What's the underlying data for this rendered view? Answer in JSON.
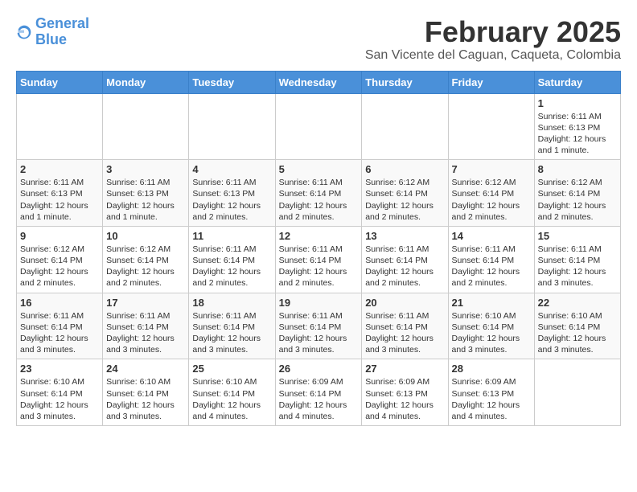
{
  "header": {
    "logo_line1": "General",
    "logo_line2": "Blue",
    "title": "February 2025",
    "subtitle": "San Vicente del Caguan, Caqueta, Colombia"
  },
  "weekdays": [
    "Sunday",
    "Monday",
    "Tuesday",
    "Wednesday",
    "Thursday",
    "Friday",
    "Saturday"
  ],
  "weeks": [
    [
      {
        "day": "",
        "info": ""
      },
      {
        "day": "",
        "info": ""
      },
      {
        "day": "",
        "info": ""
      },
      {
        "day": "",
        "info": ""
      },
      {
        "day": "",
        "info": ""
      },
      {
        "day": "",
        "info": ""
      },
      {
        "day": "1",
        "info": "Sunrise: 6:11 AM\nSunset: 6:13 PM\nDaylight: 12 hours and 1 minute."
      }
    ],
    [
      {
        "day": "2",
        "info": "Sunrise: 6:11 AM\nSunset: 6:13 PM\nDaylight: 12 hours and 1 minute."
      },
      {
        "day": "3",
        "info": "Sunrise: 6:11 AM\nSunset: 6:13 PM\nDaylight: 12 hours and 1 minute."
      },
      {
        "day": "4",
        "info": "Sunrise: 6:11 AM\nSunset: 6:13 PM\nDaylight: 12 hours and 2 minutes."
      },
      {
        "day": "5",
        "info": "Sunrise: 6:11 AM\nSunset: 6:14 PM\nDaylight: 12 hours and 2 minutes."
      },
      {
        "day": "6",
        "info": "Sunrise: 6:12 AM\nSunset: 6:14 PM\nDaylight: 12 hours and 2 minutes."
      },
      {
        "day": "7",
        "info": "Sunrise: 6:12 AM\nSunset: 6:14 PM\nDaylight: 12 hours and 2 minutes."
      },
      {
        "day": "8",
        "info": "Sunrise: 6:12 AM\nSunset: 6:14 PM\nDaylight: 12 hours and 2 minutes."
      }
    ],
    [
      {
        "day": "9",
        "info": "Sunrise: 6:12 AM\nSunset: 6:14 PM\nDaylight: 12 hours and 2 minutes."
      },
      {
        "day": "10",
        "info": "Sunrise: 6:12 AM\nSunset: 6:14 PM\nDaylight: 12 hours and 2 minutes."
      },
      {
        "day": "11",
        "info": "Sunrise: 6:11 AM\nSunset: 6:14 PM\nDaylight: 12 hours and 2 minutes."
      },
      {
        "day": "12",
        "info": "Sunrise: 6:11 AM\nSunset: 6:14 PM\nDaylight: 12 hours and 2 minutes."
      },
      {
        "day": "13",
        "info": "Sunrise: 6:11 AM\nSunset: 6:14 PM\nDaylight: 12 hours and 2 minutes."
      },
      {
        "day": "14",
        "info": "Sunrise: 6:11 AM\nSunset: 6:14 PM\nDaylight: 12 hours and 2 minutes."
      },
      {
        "day": "15",
        "info": "Sunrise: 6:11 AM\nSunset: 6:14 PM\nDaylight: 12 hours and 3 minutes."
      }
    ],
    [
      {
        "day": "16",
        "info": "Sunrise: 6:11 AM\nSunset: 6:14 PM\nDaylight: 12 hours and 3 minutes."
      },
      {
        "day": "17",
        "info": "Sunrise: 6:11 AM\nSunset: 6:14 PM\nDaylight: 12 hours and 3 minutes."
      },
      {
        "day": "18",
        "info": "Sunrise: 6:11 AM\nSunset: 6:14 PM\nDaylight: 12 hours and 3 minutes."
      },
      {
        "day": "19",
        "info": "Sunrise: 6:11 AM\nSunset: 6:14 PM\nDaylight: 12 hours and 3 minutes."
      },
      {
        "day": "20",
        "info": "Sunrise: 6:11 AM\nSunset: 6:14 PM\nDaylight: 12 hours and 3 minutes."
      },
      {
        "day": "21",
        "info": "Sunrise: 6:10 AM\nSunset: 6:14 PM\nDaylight: 12 hours and 3 minutes."
      },
      {
        "day": "22",
        "info": "Sunrise: 6:10 AM\nSunset: 6:14 PM\nDaylight: 12 hours and 3 minutes."
      }
    ],
    [
      {
        "day": "23",
        "info": "Sunrise: 6:10 AM\nSunset: 6:14 PM\nDaylight: 12 hours and 3 minutes."
      },
      {
        "day": "24",
        "info": "Sunrise: 6:10 AM\nSunset: 6:14 PM\nDaylight: 12 hours and 3 minutes."
      },
      {
        "day": "25",
        "info": "Sunrise: 6:10 AM\nSunset: 6:14 PM\nDaylight: 12 hours and 4 minutes."
      },
      {
        "day": "26",
        "info": "Sunrise: 6:09 AM\nSunset: 6:14 PM\nDaylight: 12 hours and 4 minutes."
      },
      {
        "day": "27",
        "info": "Sunrise: 6:09 AM\nSunset: 6:13 PM\nDaylight: 12 hours and 4 minutes."
      },
      {
        "day": "28",
        "info": "Sunrise: 6:09 AM\nSunset: 6:13 PM\nDaylight: 12 hours and 4 minutes."
      },
      {
        "day": "",
        "info": ""
      }
    ]
  ]
}
